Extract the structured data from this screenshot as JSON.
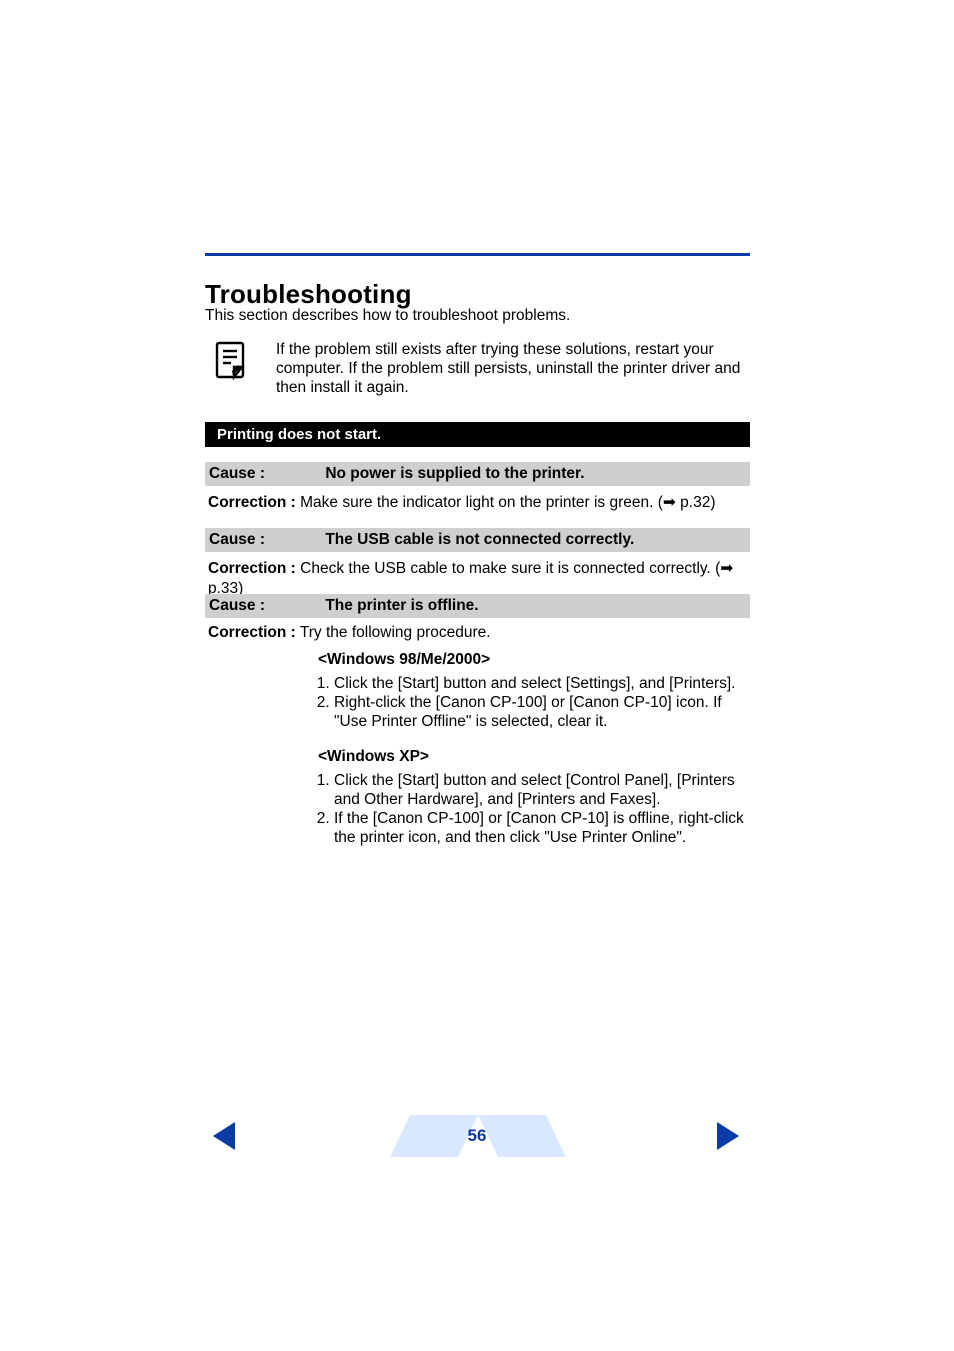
{
  "heading": "Troubleshooting",
  "intro": "This section describes how to troubleshoot problems.",
  "note": "If the problem still exists after trying these solutions, restart your computer. If the problem still persists, uninstall the printer driver and then install it again.",
  "section": {
    "title": "Printing does not start."
  },
  "labels": {
    "cause": "Cause :",
    "correction": "Correction :"
  },
  "items": [
    {
      "cause": "No power is supplied to the printer.",
      "correction": " Make sure the indicator light on the printer is green. (",
      "ref": "p.32)"
    },
    {
      "cause": "The USB cable is not connected correctly.",
      "correction": " Check the USB cable to make sure it is connected correctly. (",
      "ref": "p.33)"
    },
    {
      "cause": "The printer is offline.",
      "correction": " Try the following procedure."
    }
  ],
  "procedures": {
    "a": {
      "heading": "<Windows 98/Me/2000>",
      "steps": [
        "Click the [Start] button and select [Settings], and [Printers].",
        "Right-click the [Canon CP-100] or [Canon CP-10] icon. If \"Use Printer Offline\" is selected, clear it."
      ]
    },
    "b": {
      "heading": "<Windows XP>",
      "steps": [
        "Click the [Start] button and select [Control Panel], [Printers and Other Hardware], and [Printers and Faxes].",
        "If the [Canon CP-100] or [Canon CP-10] is offline, right-click the printer icon, and then click \"Use Printer Online\"."
      ]
    }
  },
  "page_number": "56"
}
